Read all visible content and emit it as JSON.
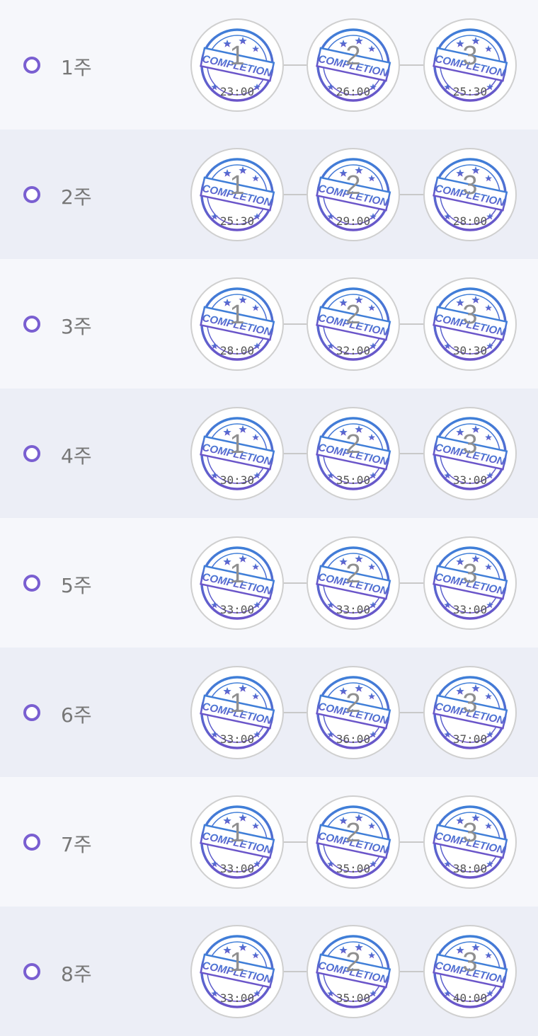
{
  "stamp_text": "COMPLETION",
  "weeks": [
    {
      "label": "1주",
      "sessions": [
        {
          "num": "1",
          "time": "23:00"
        },
        {
          "num": "2",
          "time": "26:00"
        },
        {
          "num": "3",
          "time": "25:30"
        }
      ]
    },
    {
      "label": "2주",
      "sessions": [
        {
          "num": "1",
          "time": "25:30"
        },
        {
          "num": "2",
          "time": "29:00"
        },
        {
          "num": "3",
          "time": "28:00"
        }
      ]
    },
    {
      "label": "3주",
      "sessions": [
        {
          "num": "1",
          "time": "28:00"
        },
        {
          "num": "2",
          "time": "32:00"
        },
        {
          "num": "3",
          "time": "30:30"
        }
      ]
    },
    {
      "label": "4주",
      "sessions": [
        {
          "num": "1",
          "time": "30:30"
        },
        {
          "num": "2",
          "time": "35:00"
        },
        {
          "num": "3",
          "time": "33:00"
        }
      ]
    },
    {
      "label": "5주",
      "sessions": [
        {
          "num": "1",
          "time": "33:00"
        },
        {
          "num": "2",
          "time": "33:00"
        },
        {
          "num": "3",
          "time": "33:00"
        }
      ]
    },
    {
      "label": "6주",
      "sessions": [
        {
          "num": "1",
          "time": "33:00"
        },
        {
          "num": "2",
          "time": "36:00"
        },
        {
          "num": "3",
          "time": "37:00"
        }
      ]
    },
    {
      "label": "7주",
      "sessions": [
        {
          "num": "1",
          "time": "33:00"
        },
        {
          "num": "2",
          "time": "35:00"
        },
        {
          "num": "3",
          "time": "38:00"
        }
      ]
    },
    {
      "label": "8주",
      "sessions": [
        {
          "num": "1",
          "time": "33:00"
        },
        {
          "num": "2",
          "time": "35:00"
        },
        {
          "num": "3",
          "time": "40:00"
        }
      ]
    }
  ],
  "colors": {
    "accent": "#7a5fd1",
    "stamp_blue": "#3f7fd8",
    "stamp_purple": "#6b55c9"
  },
  "icons": {
    "row_marker": "timeline-dot-icon",
    "badge": "completion-stamp-icon"
  }
}
